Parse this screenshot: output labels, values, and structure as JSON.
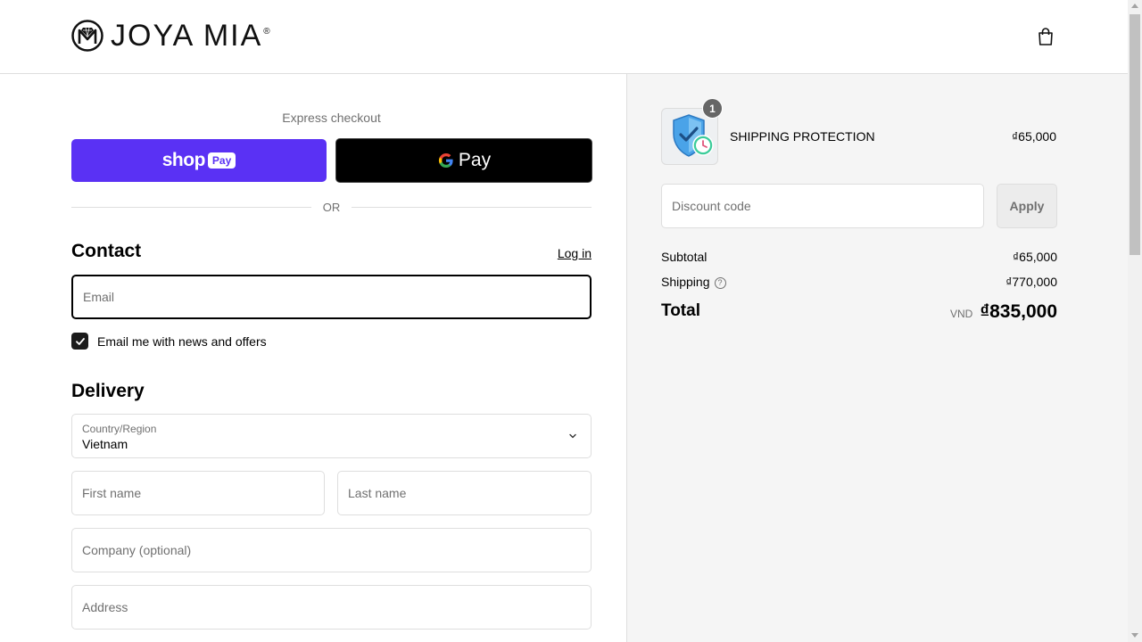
{
  "header": {
    "brand": "JOYA MIA",
    "brand_reg": "®",
    "icons": {
      "logo": "joya-mia-logo-icon",
      "cart": "shopping-bag-icon"
    }
  },
  "express": {
    "label": "Express checkout",
    "shoppay_word": "shop",
    "shoppay_badge": "Pay",
    "gpay_word": "Pay",
    "or": "OR",
    "colors": {
      "shoppay": "#5a31f4",
      "gpay": "#000000"
    }
  },
  "contact": {
    "title": "Contact",
    "login": "Log in",
    "email_placeholder": "Email",
    "newsletter_label": "Email me with news and offers",
    "newsletter_checked": true
  },
  "delivery": {
    "title": "Delivery",
    "country_label": "Country/Region",
    "country_value": "Vietnam",
    "first_name_placeholder": "First name",
    "last_name_placeholder": "Last name",
    "company_placeholder": "Company (optional)",
    "address_placeholder": "Address"
  },
  "summary": {
    "item": {
      "quantity": "1",
      "name": "SHIPPING PROTECTION",
      "price": "₫65,000",
      "icon": "shield-check-clock-icon"
    },
    "discount_placeholder": "Discount code",
    "apply_label": "Apply",
    "subtotal_label": "Subtotal",
    "subtotal_value": "₫65,000",
    "shipping_label": "Shipping",
    "shipping_info": "?",
    "shipping_value": "₫770,000",
    "total_label": "Total",
    "total_currency": "VND",
    "total_value": "₫835,000"
  }
}
